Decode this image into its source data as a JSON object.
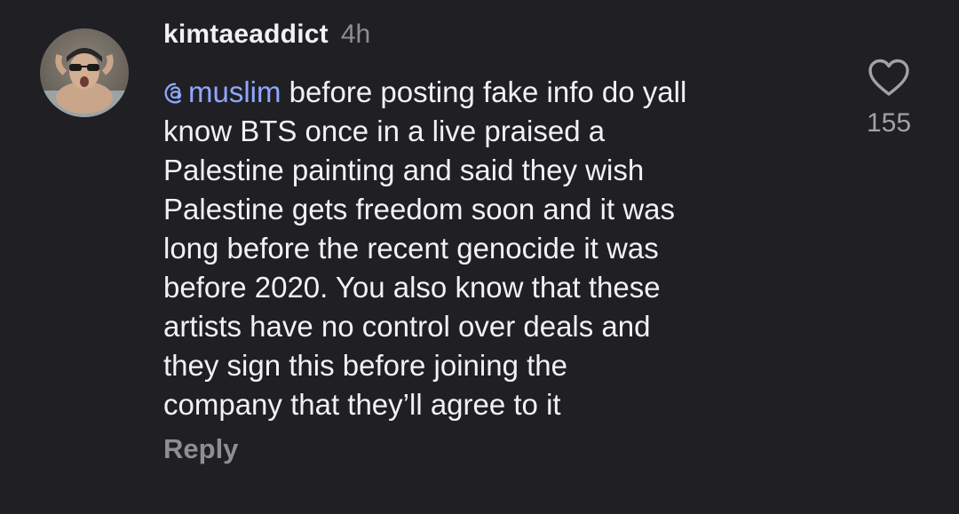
{
  "comment": {
    "username": "kimtaeaddict",
    "time": "4h",
    "mention": "muslim",
    "text": " before posting fake info do yall\nknow BTS once in a live praised a\nPalestine painting and said they wish\nPalestine gets freedom soon and it was\nlong before the recent genocide it was\nbefore 2020. You also know that these\nartists have no control over deals and\nthey sign this before joining the\ncompany that they’ll agree to it",
    "reply_label": "Reply",
    "like_count": "155"
  },
  "icons": {
    "avatar": "user-avatar-photo",
    "mention": "threads-at-icon",
    "like": "heart-outline-icon"
  },
  "colors": {
    "background": "#1f1f24",
    "text": "#f2f2f2",
    "secondary": "#8e8e93",
    "mention": "#8fa7ff"
  }
}
